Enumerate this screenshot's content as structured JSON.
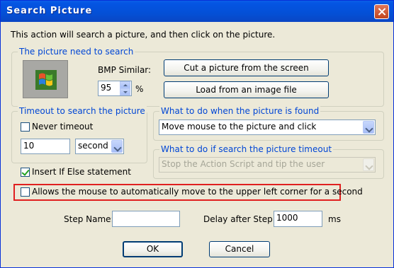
{
  "window": {
    "title": "Search Picture"
  },
  "description": "This action will search a picture, and then click on the picture.",
  "picture_group": {
    "legend": "The picture need to search",
    "icon": "windows-logo-icon",
    "bmp_similar_label": "BMP Similar:",
    "bmp_similar_value": "95",
    "percent_label": "%",
    "cut_button": "Cut a picture from the screen",
    "load_button": "Load from an image file"
  },
  "timeout_group": {
    "legend": "Timeout to search the picture",
    "never_timeout_label": "Never timeout",
    "never_timeout_checked": false,
    "timeout_value": "10",
    "unit_selected": "second"
  },
  "found_group": {
    "legend": "What to do when the picture is found",
    "selected": "Move mouse to the picture and click"
  },
  "timeout_action_group": {
    "legend": "What to do if search the picture timeout",
    "selected": "Stop the Action Script and tip the user"
  },
  "insert_if_else": {
    "label": "Insert If Else statement",
    "checked": true
  },
  "allow_mouse_move": {
    "label": "Allows the mouse to automatically move to the upper left corner for a second",
    "checked": false
  },
  "step": {
    "name_label": "Step Name:",
    "name_value": "",
    "delay_label": "Delay after Step:",
    "delay_value": "1000",
    "delay_unit": "ms"
  },
  "buttons": {
    "ok": "OK",
    "cancel": "Cancel"
  },
  "colors": {
    "titlebar": "#0454e2",
    "legend_text": "#0046d5",
    "highlight_box": "#e02020",
    "dialog_bg": "#ece9d8"
  }
}
